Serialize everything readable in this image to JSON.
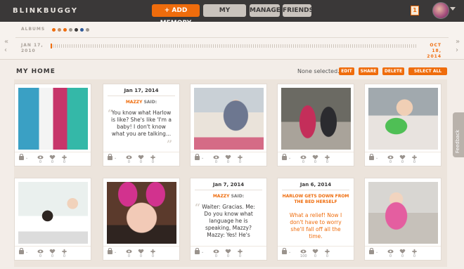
{
  "app": {
    "logo": "BLINKBUGGY"
  },
  "nav": {
    "add_memory": "+ ADD MEMORY",
    "my_memories": "MY MEMORIES",
    "manage": "MANAGE",
    "friends": "FRIENDS",
    "notifications": "1"
  },
  "timeline": {
    "albums_label": "ALBUMS",
    "album_dot_colors": [
      "#ef6c0c",
      "#c88d61",
      "#ef6c0c",
      "#9c968f",
      "#3a3838",
      "#2f5a9a",
      "#9c968f"
    ],
    "start_date": "JAN 17, 2010",
    "end_date": "OCT 18, 2014",
    "prev_arrow": "«",
    "next_arrow": "»",
    "left_arrow": "‹",
    "right_arrow": "›"
  },
  "home": {
    "title": "MY HOME",
    "selection_status": "None selected.",
    "edit": "EDIT",
    "share": "SHARE",
    "delete": "DELETE",
    "select_all": "SELECT ALL"
  },
  "cards": [
    {
      "kind": "photo",
      "views": "0",
      "likes": "0",
      "comments": "0"
    },
    {
      "kind": "quote",
      "date": "Jan 17, 2014",
      "who": "MAZZY",
      "said": "SAID:",
      "quote": "You know what Harlow is like? She's like 'I'm a baby! I don't know what you are talking...",
      "views": "0",
      "likes": "0",
      "comments": "0"
    },
    {
      "kind": "photo",
      "views": "0",
      "likes": "0",
      "comments": "0"
    },
    {
      "kind": "photo",
      "views": "0",
      "likes": "0",
      "comments": "0"
    },
    {
      "kind": "photo",
      "views": "0",
      "likes": "0",
      "comments": "0"
    },
    {
      "kind": "photo",
      "views": "0",
      "likes": "0",
      "comments": "0"
    },
    {
      "kind": "photo",
      "views": "0",
      "likes": "0",
      "comments": "0"
    },
    {
      "kind": "quote",
      "date": "Jan 7, 2014",
      "who": "MAZZY",
      "said": "SAID:",
      "quote": "Waiter: Gracias. Me: Do you know what language he is speaking, Mazzy? Mazzy: Yes! He's",
      "views": "0",
      "likes": "0",
      "comments": "0"
    },
    {
      "kind": "headline",
      "date": "Jan 6, 2014",
      "headline": "HARLOW GETS DOWN FROM THE BED HERSELF",
      "text": "What a relief! Now I don't have to worry she'll fall off all the time.",
      "views": "100",
      "likes": "0",
      "comments": "0"
    },
    {
      "kind": "photo",
      "views": "0",
      "likes": "0",
      "comments": "0"
    }
  ],
  "feedback": "Feedback",
  "colors": {
    "accent": "#ef6c0c",
    "topbar": "#3a3838",
    "page_bg": "#f3ede8"
  }
}
